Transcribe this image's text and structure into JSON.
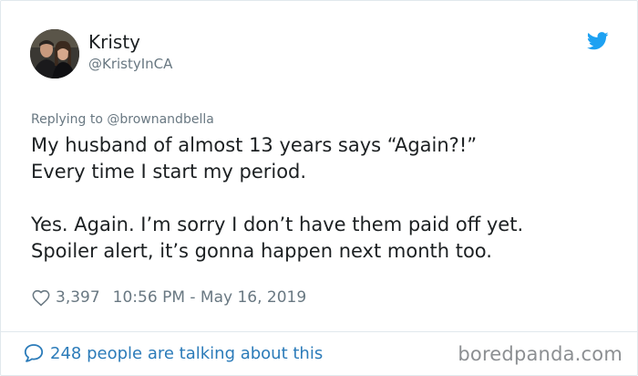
{
  "tweet": {
    "author": {
      "name": "Kristy",
      "handle": "@KristyInCA"
    },
    "replying_to": "Replying to @brownandbella",
    "lines": [
      "My husband of almost 13 years says “Again?!”",
      "Every time I start my period.",
      "",
      "Yes.  Again. I’m sorry I don’t have them paid off yet.",
      "Spoiler alert, it’s gonna happen next month too."
    ],
    "likes": "3,397",
    "timestamp": "10:56 PM - May 16, 2019"
  },
  "footer": {
    "talking": "248 people are talking about this",
    "watermark": "boredpanda.com"
  },
  "colors": {
    "twitter_blue": "#1da1f2",
    "link_blue": "#2b7bb9",
    "muted": "#697882",
    "text": "#1c2022"
  },
  "icons": {
    "logo": "twitter-bird-icon",
    "like": "heart-icon",
    "conversation": "speech-bubble-icon"
  }
}
